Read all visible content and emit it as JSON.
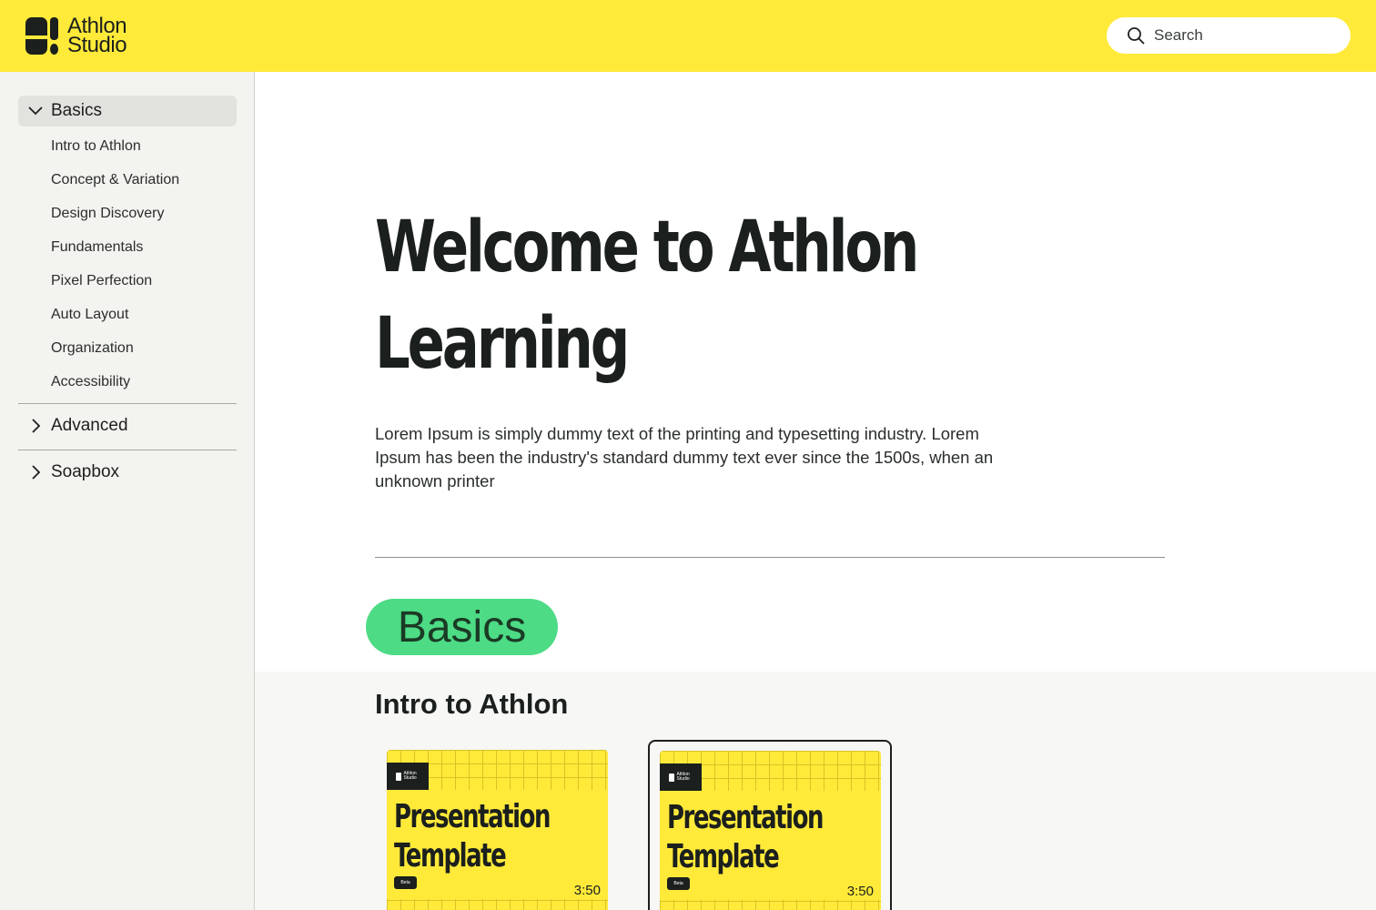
{
  "header": {
    "logo_line1": "Athlon",
    "logo_line2": "Studio",
    "search_placeholder": "Search"
  },
  "sidebar": {
    "groups": [
      {
        "label": "Basics",
        "expanded": true,
        "items": [
          "Intro to Athlon",
          "Concept & Variation",
          "Design Discovery",
          "Fundamentals",
          "Pixel Perfection",
          "Auto Layout",
          "Organization",
          "Accessibility"
        ]
      },
      {
        "label": "Advanced",
        "expanded": false
      },
      {
        "label": "Soapbox",
        "expanded": false
      }
    ]
  },
  "main": {
    "hero_title_line1": "Welcome to Athlon",
    "hero_title_line2": "Learning",
    "hero_body": "Lorem Ipsum is simply dummy text of the printing and typesetting industry. Lorem Ipsum has been the industry's standard dummy text ever since the 1500s, when an unknown printer",
    "section_pill": "Basics",
    "section_title": "Intro to Athlon",
    "cards": [
      {
        "logo_text": "Athlon Studio",
        "title_line1": "Presentation",
        "title_line2": "Template",
        "tag": "Beta",
        "duration": "3:50",
        "selected": false
      },
      {
        "logo_text": "Athlon Studio",
        "title_line1": "Presentation",
        "title_line2": "Template",
        "tag": "Beta",
        "duration": "3:50",
        "selected": true
      }
    ]
  },
  "colors": {
    "brand_yellow": "#ffea3a",
    "pill_green": "#4ddb85",
    "ink": "#1b1f1d",
    "sidebar_bg": "#f3f3f0"
  }
}
